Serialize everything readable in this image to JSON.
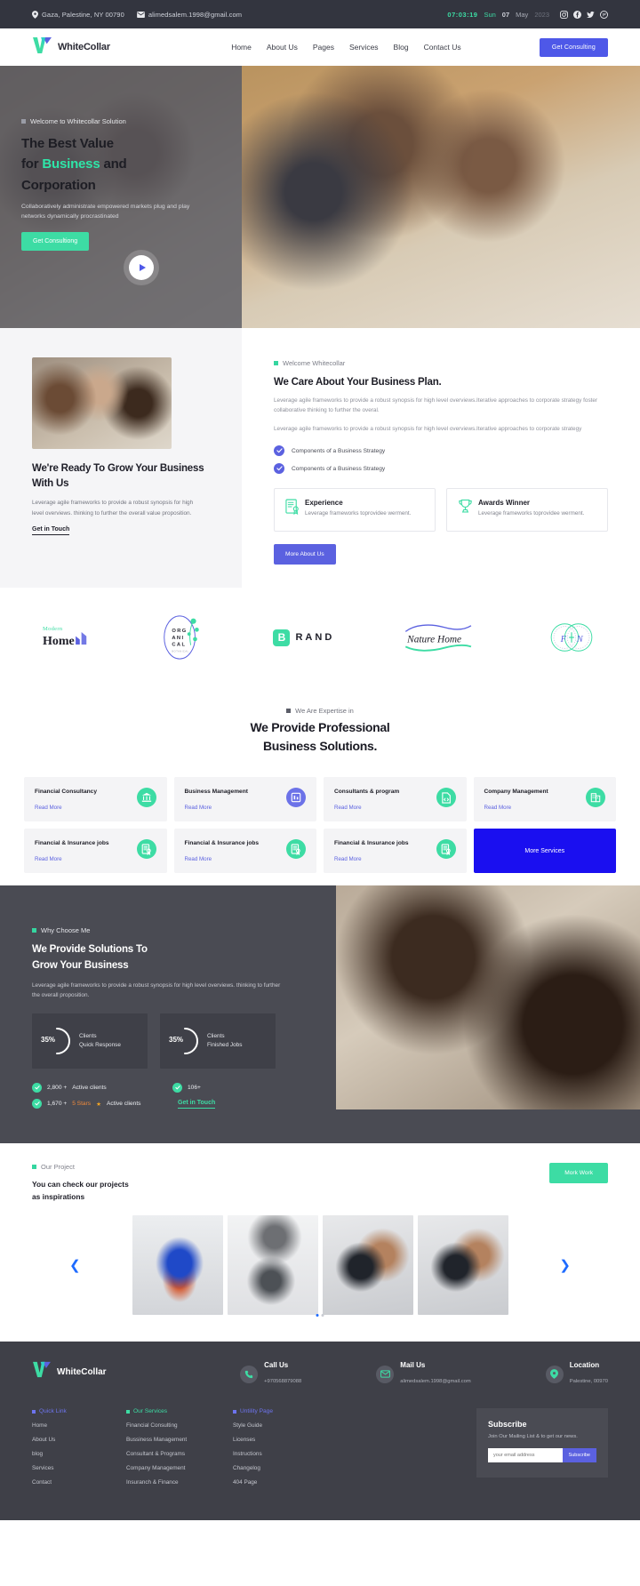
{
  "topbar": {
    "location": "Gaza, Palestine, NY 00790",
    "email": "alimedsalem.1998@gmail.com",
    "time": "07:03:19",
    "day": "Sun",
    "date": "07",
    "month": "May",
    "year": "2023",
    "socials": [
      "instagram-icon",
      "facebook-icon",
      "twitter-icon",
      "pinterest-icon"
    ]
  },
  "nav": {
    "brand": "WhiteCollar",
    "menu": [
      "Home",
      "About Us",
      "Pages",
      "Services",
      "Blog",
      "Contact Us"
    ],
    "cta": "Get Consulting"
  },
  "hero": {
    "eyebrow": "Welcome to Whitecollar Solution",
    "title_line1": "The Best Value",
    "title_line2_pre": "for ",
    "title_line2_hl": "Business",
    "title_line2_post": " and",
    "title_line3": "Corporation",
    "paragraph": "Collaboratively administrate empowered markets plug and play networks dynamically procrastinated",
    "cta": "Get Consultiong",
    "play": "play-icon"
  },
  "about": {
    "left": {
      "title": "We're Ready To Grow Your Business With Us",
      "paragraph": "Leverage agile frameworks to provide a robust synopsis for high level overviews. thinking to further the overall value proposition.",
      "link": "Get in Touch"
    },
    "right": {
      "eyebrow": "Welcome Whitecollar",
      "title": "We Care About Your Business Plan.",
      "paragraph1": "Leverage agile frameworks to provide a robust synopsis for high level overviews.Iterative approaches to corporate strategy foster collaborative thinking to further the overal.",
      "paragraph2": "Leverage agile frameworks to provide a robust synopsis for high level overviews.Iterative approaches to corporate strategy",
      "checks": [
        "Components of a Business Strategy",
        "Components of a Business Strategy"
      ],
      "cards": [
        {
          "icon": "certificate-icon",
          "title": "Experience",
          "text": "Leverage frameworks toprovidee werment."
        },
        {
          "icon": "trophy-icon",
          "title": "Awards Winner",
          "text": "Leverage frameworks toprovidee werment."
        }
      ],
      "cta": "More About Us"
    }
  },
  "brands": [
    {
      "name": "modern-home-logo",
      "top": "Modern",
      "main": "Home"
    },
    {
      "name": "organical-logo",
      "l1": "ORG",
      "l2": "ANI",
      "l3": "CAL",
      "sub": "BOTANICAL"
    },
    {
      "name": "brand-logo",
      "badge": "B",
      "text": "RAND"
    },
    {
      "name": "nature-home-logo",
      "text": "Nature Home"
    },
    {
      "name": "fn-logo",
      "text": "F  N"
    }
  ],
  "services": {
    "eyebrow": "We Are Expertise in",
    "title_line1": "We Provide Professional",
    "title_line2": "Business Solutions.",
    "read_more": "Read More",
    "cards": [
      {
        "title": "Financial Consultancy",
        "icon": "bank-icon",
        "color": "green"
      },
      {
        "title": "Business Management",
        "icon": "chart-icon",
        "color": "purple"
      },
      {
        "title": "Consultants & program",
        "icon": "code-file-icon",
        "color": "green"
      },
      {
        "title": "Company Management",
        "icon": "building-icon",
        "color": "green"
      },
      {
        "title": "Financial & Insurance jobs",
        "icon": "certificate-icon",
        "color": "green"
      },
      {
        "title": "Financial & Insurance jobs",
        "icon": "certificate-icon",
        "color": "green"
      },
      {
        "title": "Financial & Insurance jobs",
        "icon": "certificate-icon",
        "color": "green"
      }
    ],
    "more": "More Services"
  },
  "why": {
    "eyebrow": "Why Choose Me",
    "title_line1": "We Provide Solutions To",
    "title_line2": "Grow Your Business",
    "paragraph": "Leverage agile frameworks to provide a robust synopsis for high level overviews. thinking to further the overall proposition.",
    "stats": [
      {
        "percent": "35%",
        "label_line1": "Clients",
        "label_line2": "Quick Response",
        "value": 35
      },
      {
        "percent": "35%",
        "label_line1": "Clients",
        "label_line2": "Finished Jobs",
        "value": 35
      }
    ],
    "facts": [
      {
        "value": "2,800 +",
        "label": "Active clients"
      },
      {
        "value": "106+",
        "label": ""
      },
      {
        "value": "1,670 +",
        "stars": "5 Stars",
        "label": "Active clients"
      }
    ],
    "link": "Get in Touch"
  },
  "projects": {
    "eyebrow": "Our Project",
    "title_line1": "You can check our projects",
    "title_line2": "as inspirations",
    "cta": "Mork Work",
    "images": [
      "project-monitor-setup",
      "project-man-laptop",
      "project-phone-chart-1",
      "project-phone-chart-2"
    ],
    "dots": 2,
    "active_dot": 0
  },
  "footer": {
    "brand": "WhiteCollar",
    "contacts": [
      {
        "icon": "phone-icon",
        "title": "Call Us",
        "value": "+970568879088"
      },
      {
        "icon": "mail-icon",
        "title": "Mail Us",
        "value": "alimedsalem.1998@gmail.com"
      },
      {
        "icon": "location-icon",
        "title": "Location",
        "value": "Palestine, 00970"
      }
    ],
    "columns": [
      {
        "title": "Quick Link",
        "links": [
          "Home",
          "About Us",
          "blog",
          "Services",
          "Contact"
        ]
      },
      {
        "title": "Our Services",
        "links": [
          "Financial Consulting",
          "Bussiness Management",
          "Consultant & Programs",
          "Company Management",
          "Insuranch & Finance"
        ]
      },
      {
        "title": "Untility Page",
        "links": [
          "Style Guide",
          "Licenses",
          "Instructions",
          "Changelog",
          "404 Page"
        ]
      }
    ],
    "subscribe": {
      "title": "Subscribe",
      "text": "Join Our Mailing List & to get our news.",
      "placeholder": "your email address",
      "button": "Subscribe"
    }
  },
  "colors": {
    "green": "#3ddca4",
    "purple": "#5b61e0",
    "dark": "#3f4048",
    "blue": "#1a0ff0"
  }
}
